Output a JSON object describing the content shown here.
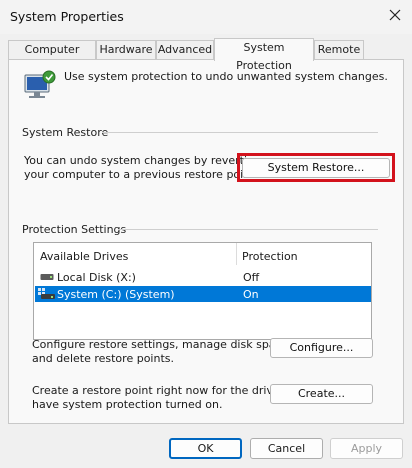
{
  "window": {
    "title": "System Properties"
  },
  "tabs": [
    {
      "label": "Computer Name",
      "active": false
    },
    {
      "label": "Hardware",
      "active": false
    },
    {
      "label": "Advanced",
      "active": false
    },
    {
      "label": "System Protection",
      "active": true
    },
    {
      "label": "Remote",
      "active": false
    }
  ],
  "intro": {
    "text": "Use system protection to undo unwanted system changes.",
    "icon": "computer-shield-icon"
  },
  "system_restore": {
    "group_title": "System Restore",
    "description_line1": "You can undo system changes by reverting",
    "description_line2": "your computer to a previous restore point.",
    "button_label": "System Restore...",
    "highlight_color": "#d3121c"
  },
  "protection_settings": {
    "group_title": "Protection Settings",
    "columns": [
      "Available Drives",
      "Protection"
    ],
    "rows": [
      {
        "drive": "Local Disk (X:)",
        "protection": "Off",
        "selected": false,
        "icon": "drive-icon"
      },
      {
        "drive": "System (C:) (System)",
        "protection": "On",
        "selected": true,
        "icon": "system-drive-icon"
      }
    ],
    "configure_text_line1": "Configure restore settings, manage disk space,",
    "configure_text_line2": "and delete restore points.",
    "configure_button": "Configure...",
    "create_text_line1": "Create a restore point right now for the drives that",
    "create_text_line2": "have system protection turned on.",
    "create_button": "Create..."
  },
  "footer": {
    "ok": "OK",
    "cancel": "Cancel",
    "apply": "Apply"
  },
  "colors": {
    "selection": "#0078d7",
    "ok_border": "#0067c0"
  }
}
